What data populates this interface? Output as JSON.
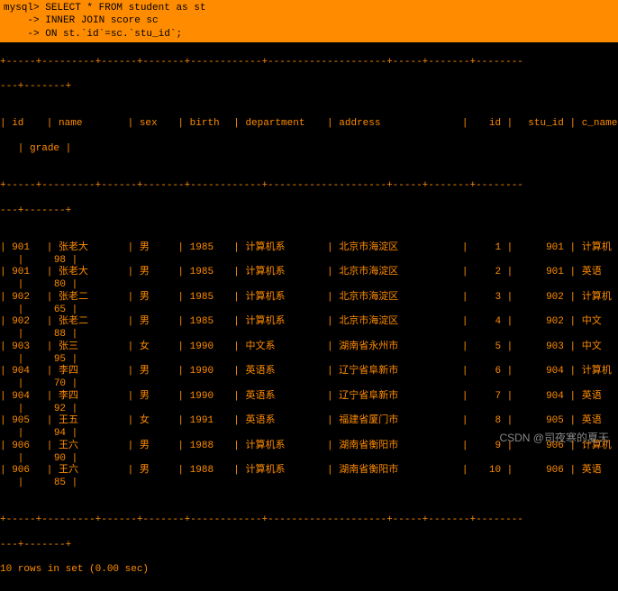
{
  "query": {
    "prompt": "mysql>",
    "line1": "SELECT * FROM student as st",
    "cont": "    ->",
    "line2": "INNER JOIN score sc",
    "line3": "ON st.`id`=sc.`stu_id`;"
  },
  "sep1": "+-----+---------+------+-------+------------+--------------------+-----+-------+--------",
  "sep2": "---+-------+",
  "headers": {
    "id": "id",
    "name": "name",
    "sex": "sex",
    "birth": "birth",
    "department": "department",
    "address": "address",
    "id2": "id",
    "stu_id": "stu_id",
    "c_name": "c_name",
    "grade": "grade"
  },
  "rows": [
    {
      "id": "901",
      "name": "张老大",
      "sex": "男",
      "birth": "1985",
      "dept": "计算机系",
      "addr": "北京市海淀区",
      "id2": "1",
      "stu": "901",
      "cname": "计算机",
      "grade": "98"
    },
    {
      "id": "901",
      "name": "张老大",
      "sex": "男",
      "birth": "1985",
      "dept": "计算机系",
      "addr": "北京市海淀区",
      "id2": "2",
      "stu": "901",
      "cname": "英语",
      "grade": "80"
    },
    {
      "id": "902",
      "name": "张老二",
      "sex": "男",
      "birth": "1985",
      "dept": "计算机系",
      "addr": "北京市海淀区",
      "id2": "3",
      "stu": "902",
      "cname": "计算机",
      "grade": "65"
    },
    {
      "id": "902",
      "name": "张老二",
      "sex": "男",
      "birth": "1985",
      "dept": "计算机系",
      "addr": "北京市海淀区",
      "id2": "4",
      "stu": "902",
      "cname": "中文",
      "grade": "88"
    },
    {
      "id": "903",
      "name": "张三",
      "sex": "女",
      "birth": "1990",
      "dept": "中文系",
      "addr": "湖南省永州市",
      "id2": "5",
      "stu": "903",
      "cname": "中文",
      "grade": "95"
    },
    {
      "id": "904",
      "name": "李四",
      "sex": "男",
      "birth": "1990",
      "dept": "英语系",
      "addr": "辽宁省阜新市",
      "id2": "6",
      "stu": "904",
      "cname": "计算机",
      "grade": "70"
    },
    {
      "id": "904",
      "name": "李四",
      "sex": "男",
      "birth": "1990",
      "dept": "英语系",
      "addr": "辽宁省阜新市",
      "id2": "7",
      "stu": "904",
      "cname": "英语",
      "grade": "92"
    },
    {
      "id": "905",
      "name": "王五",
      "sex": "女",
      "birth": "1991",
      "dept": "英语系",
      "addr": "福建省厦门市",
      "id2": "8",
      "stu": "905",
      "cname": "英语",
      "grade": "94"
    },
    {
      "id": "906",
      "name": "王六",
      "sex": "男",
      "birth": "1988",
      "dept": "计算机系",
      "addr": "湖南省衡阳市",
      "id2": "9",
      "stu": "906",
      "cname": "计算机",
      "grade": "90"
    },
    {
      "id": "906",
      "name": "王六",
      "sex": "男",
      "birth": "1988",
      "dept": "计算机系",
      "addr": "湖南省衡阳市",
      "id2": "10",
      "stu": "906",
      "cname": "英语",
      "grade": "85"
    }
  ],
  "footer": "10 rows in set (0.00 sec)",
  "watermark": "CSDN @司夜寒的夏天"
}
